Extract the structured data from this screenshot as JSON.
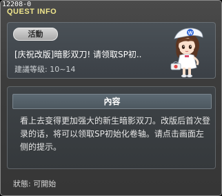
{
  "window": {
    "quest_id": "12208-0",
    "title": "QUEST INFO"
  },
  "quest": {
    "category_badge": "活動",
    "title": "[庆祝改版]暗影双刀! 请领取SP初..",
    "level_info": "建議等级: 10~14"
  },
  "npc": {
    "icon": "nurse-girl-npc-icon",
    "cap_letter": "W"
  },
  "content": {
    "header": "內容",
    "body": "看上去变得更加强大的新生暗影双刀。改版后首次登录的话，将可以领取SP初始化卷轴。请点击画面左侧的提示。"
  },
  "status": {
    "text": "狀態: 可開始"
  }
}
